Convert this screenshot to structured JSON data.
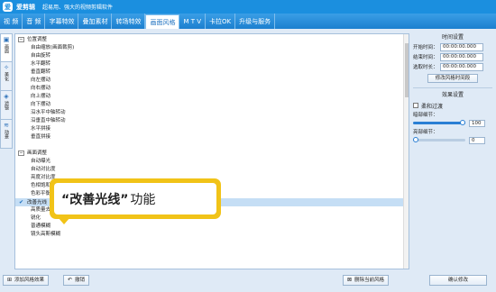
{
  "app": {
    "logo_text": "爱",
    "name": "爱剪辑",
    "tagline": "超易用、强大的视频剪辑软件"
  },
  "menu": [
    {
      "label": "视 频",
      "name": "menu-video"
    },
    {
      "label": "音 频",
      "name": "menu-audio"
    },
    {
      "label": "字幕特效",
      "name": "menu-subtitle-effects"
    },
    {
      "label": "叠加素材",
      "name": "menu-overlay"
    },
    {
      "label": "转场特效",
      "name": "menu-transition"
    },
    {
      "label": "画面风格",
      "name": "menu-picture-style"
    },
    {
      "label": "M T V",
      "name": "menu-mtv"
    },
    {
      "label": "卡拉OK",
      "name": "menu-karaoke"
    },
    {
      "label": "升级与服务",
      "name": "menu-upgrade"
    }
  ],
  "side_tabs": [
    {
      "label": "画面",
      "icon": "frame-icon",
      "glyph": "▣"
    },
    {
      "label": "美化",
      "icon": "beautify-icon",
      "glyph": "✧"
    },
    {
      "label": "滤镜",
      "icon": "filter-icon",
      "glyph": "◈"
    },
    {
      "label": "动景",
      "icon": "motion-icon",
      "glyph": "≋"
    }
  ],
  "tree": [
    {
      "type": "group",
      "label": "位置调整"
    },
    {
      "type": "item",
      "label": "自由缩放(画面裁剪)"
    },
    {
      "type": "item",
      "label": "自由旋转"
    },
    {
      "type": "item",
      "label": "水平翻转"
    },
    {
      "type": "item",
      "label": "垂直翻转"
    },
    {
      "type": "item",
      "label": "向左摆动"
    },
    {
      "type": "item",
      "label": "向右摆动"
    },
    {
      "type": "item",
      "label": "向上摆动"
    },
    {
      "type": "item",
      "label": "向下摆动"
    },
    {
      "type": "item",
      "label": "沿水平中轴转动"
    },
    {
      "type": "item",
      "label": "沿垂直中轴转动"
    },
    {
      "type": "item",
      "label": "水平拼接"
    },
    {
      "type": "item",
      "label": "垂直拼接"
    },
    {
      "type": "group",
      "label": "画面调整"
    },
    {
      "type": "item",
      "label": "自动曝光"
    },
    {
      "type": "item",
      "label": "自动对比度"
    },
    {
      "type": "item",
      "label": "亮度对比度"
    },
    {
      "type": "item",
      "label": "色相饱和度"
    },
    {
      "type": "item",
      "label": "色彩平衡"
    },
    {
      "type": "selected",
      "label": "改善光线"
    },
    {
      "type": "item",
      "label": "高质量去噪点"
    },
    {
      "type": "item",
      "label": "锐化"
    },
    {
      "type": "item",
      "label": "普通模糊"
    },
    {
      "type": "item",
      "label": "镜头高斯模糊"
    }
  ],
  "group_toggle_symbol": "−",
  "callout": {
    "quote": "“改善光线”",
    "suffix": "功能"
  },
  "time_settings": {
    "title": "时间设置",
    "start_label": "开始时间：",
    "start_value": "00:00:00.000",
    "end_label": "结束时间：",
    "end_value": "00:00:00.000",
    "duration_label": "选取时长：",
    "duration_value": "00:00:00.000",
    "modify_button": "修改风格时间段"
  },
  "effect_settings": {
    "title": "效果设置",
    "soft_transition_label": "柔和过渡",
    "dark_label": "暗部细节：",
    "dark_value": "100",
    "dark_fraction": 1.0,
    "bright_label": "亮部细节：",
    "bright_value": "0",
    "bright_fraction": 0.0
  },
  "bottom": {
    "add_button": "添加风格效果",
    "undo_button": "撤销",
    "delete_button": "删除当前风格",
    "confirm_button": "确认修改"
  },
  "colors": {
    "brand_blue": "#1b8fdf",
    "callout_yellow": "#f1c318",
    "selection": "#c5def5"
  }
}
